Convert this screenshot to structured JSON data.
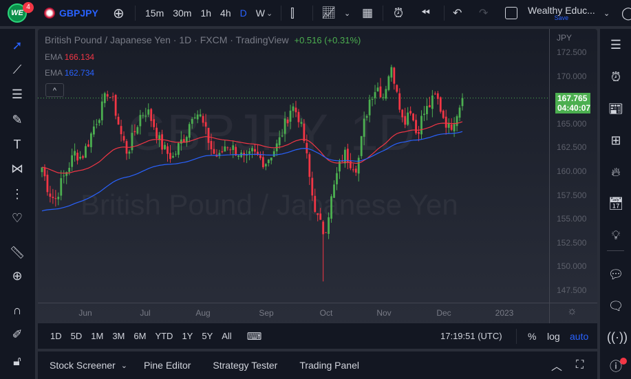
{
  "topbar": {
    "logo_text": "WE",
    "notif_count": "4",
    "symbol": "GBPJPY",
    "intervals": [
      "15m",
      "30m",
      "1h",
      "4h",
      "D",
      "W"
    ],
    "active_interval": "D",
    "layout_name": "Wealthy Educ...",
    "save_label": "Save"
  },
  "legend": {
    "title": "British Pound / Japanese Yen · 1D · FXCM · TradingView",
    "change": "+0.516 (+0.31%)",
    "ema1_label": "EMA",
    "ema1_value": "166.134",
    "ema2_label": "EMA",
    "ema2_value": "162.734"
  },
  "watermark": {
    "line1": "GBPJPY, 1D",
    "line2": "British Pound / Japanese Yen"
  },
  "price_axis": {
    "currency": "JPY",
    "ticks": [
      "172.500",
      "170.000",
      "165.000",
      "162.500",
      "160.000",
      "157.500",
      "155.000",
      "152.500",
      "150.000",
      "147.500"
    ],
    "last_price": "167.765",
    "countdown": "04:40:07"
  },
  "time_axis": {
    "ticks": [
      "Jun",
      "Jul",
      "Aug",
      "Sep",
      "Oct",
      "Nov",
      "Dec",
      "2023"
    ]
  },
  "range_bar": {
    "ranges": [
      "1D",
      "5D",
      "1M",
      "3M",
      "6M",
      "YTD",
      "1Y",
      "5Y",
      "All"
    ],
    "clock": "17:19:51 (UTC)",
    "pct": "%",
    "log": "log",
    "auto": "auto"
  },
  "bottom_panel": {
    "tabs": [
      "Stock Screener",
      "Pine Editor",
      "Strategy Tester",
      "Trading Panel"
    ]
  },
  "colors": {
    "up": "#26a69a",
    "up_candle": "#4caf50",
    "down": "#f23645",
    "ema1": "#f23645",
    "ema2": "#2962ff",
    "accent": "#2962ff",
    "last_price": "#4caf50"
  },
  "chart_data": {
    "type": "candlestick",
    "symbol": "GBPJPY",
    "timeframe": "1D",
    "ylim": [
      146.5,
      173.5
    ],
    "anchor_closes": [
      160.5,
      158,
      157,
      159,
      160.5,
      162,
      161.5,
      163,
      165,
      166.5,
      168.5,
      167,
      164,
      162,
      164,
      166,
      166.5,
      165,
      163,
      162,
      161.5,
      163,
      164,
      166.5,
      166,
      164,
      162,
      161.5,
      163,
      162.5,
      162,
      161,
      162,
      161.5,
      161,
      162,
      163,
      165,
      167,
      166,
      163,
      158,
      155,
      153.5,
      157,
      160,
      162,
      161,
      160.5,
      165,
      168,
      169,
      168,
      171,
      169,
      165,
      167,
      164,
      166,
      167,
      168,
      166,
      164.5,
      166,
      167.765
    ],
    "ema1_seed": 160.5,
    "ema1_period": 50,
    "ema2_seed": 155.8,
    "ema2_period": 200,
    "low_min": 148.5,
    "high_max": 171.8,
    "last_close": 167.765
  }
}
